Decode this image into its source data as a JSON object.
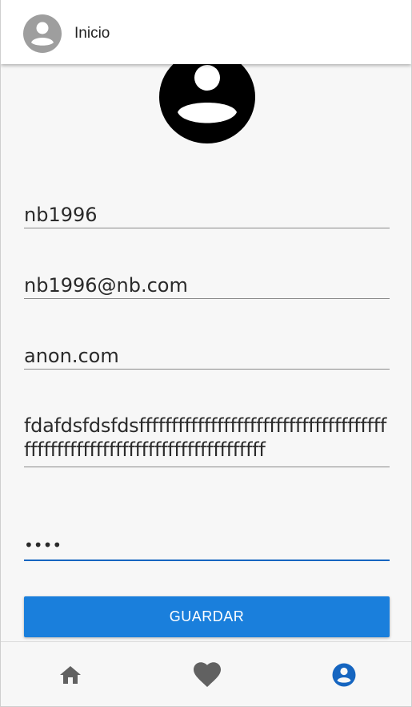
{
  "header": {
    "title": "Inicio",
    "avatar_icon": "account-circle-icon"
  },
  "profile": {
    "avatar_icon": "account-circle-icon",
    "username": "nb1996",
    "email": "nb1996@nb.com",
    "website": "anon.com",
    "bio": "fdafdsfdsfdsfffffffffffffffffffffffffffffffffffffffffffffffffffffffffffffffffffffffffff",
    "password_mask": "••••"
  },
  "actions": {
    "save_label": "GUARDAR"
  },
  "bottom_nav": {
    "items": [
      {
        "icon": "home-icon",
        "active": false
      },
      {
        "icon": "heart-icon",
        "active": false
      },
      {
        "icon": "account-circle-icon",
        "active": true
      }
    ]
  },
  "colors": {
    "accent": "#1a7fdc",
    "active_nav": "#1565c0",
    "inactive_nav": "#616161",
    "background": "#f7f7f7"
  }
}
